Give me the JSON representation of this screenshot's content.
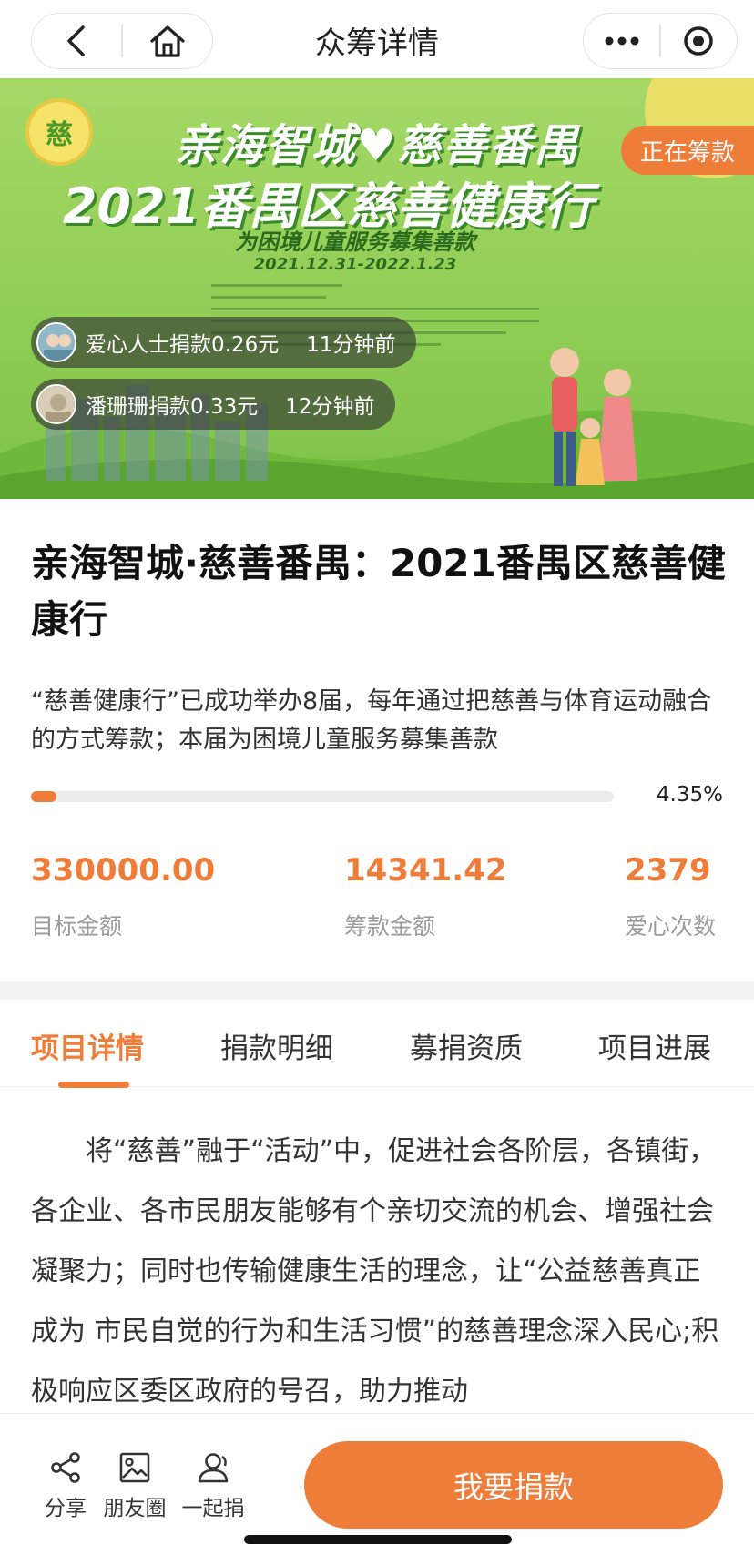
{
  "nav": {
    "title": "众筹详情"
  },
  "banner": {
    "line1": "亲海智城♥慈善番禺",
    "line2": "2021番禺区慈善健康行",
    "line3": "为困境儿童服务募集善款",
    "line4": "2021.12.31-2022.1.23",
    "logo_char": "慈",
    "status": "正在筹款"
  },
  "tickers": [
    {
      "text": "爱心人士捐款0.26元",
      "time": "11分钟前"
    },
    {
      "text": "潘珊珊捐款0.33元",
      "time": "12分钟前"
    }
  ],
  "project": {
    "title": "亲海智城·慈善番禺：2021番禺区慈善健康行",
    "description": "“慈善健康行”已成功举办8届，每年通过把慈善与体育运动融合的方式筹款；本届为困境儿童服务募集善款",
    "progress": 0.0435,
    "progress_label": "4.35%"
  },
  "stats": [
    {
      "value": "330000.00",
      "label": "目标金额"
    },
    {
      "value": "14341.42",
      "label": "筹款金额"
    },
    {
      "value": "2379",
      "label": "爱心次数"
    }
  ],
  "tabs": [
    {
      "label": "项目详情",
      "active": true
    },
    {
      "label": "捐款明细",
      "active": false
    },
    {
      "label": "募捐资质",
      "active": false
    },
    {
      "label": "项目进展",
      "active": false
    }
  ],
  "article": {
    "text": "将“慈善”融于“活动”中，促进社会各阶层，各镇街，各企业、各市民朋友能够有个亲切交流的机会、增强社会凝聚力；同时也传输健康生活的理念，让“公益慈善真正成为 市民自觉的行为和生活习惯”的慈善理念深入民心;积极响应区委区政府的号召，助力推动"
  },
  "bottom": {
    "share_label": "分享",
    "moments_label": "朋友圈",
    "together_label": "一起捐",
    "donate_label": "我要捐款"
  },
  "colors": {
    "accent": "#ef7d3a",
    "muted_text": "#9a9a9a",
    "banner_green": "#8fce55"
  }
}
